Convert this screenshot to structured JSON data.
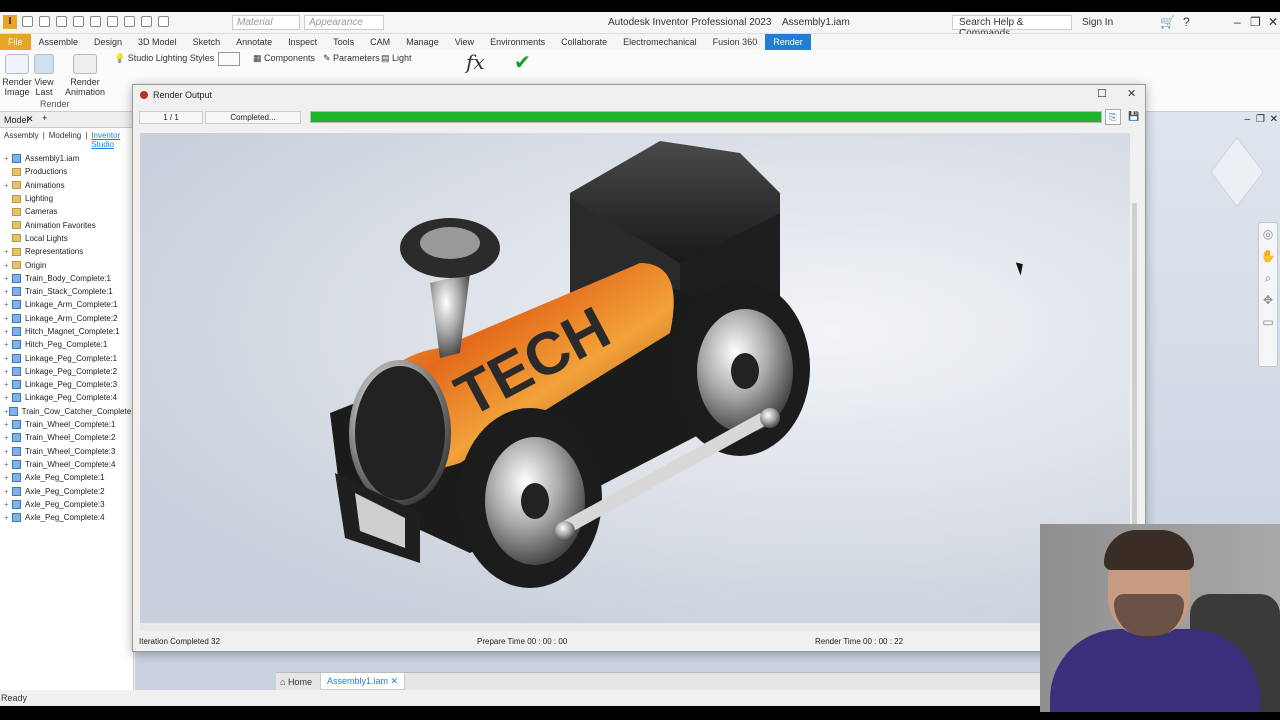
{
  "app": {
    "title": "Autodesk Inventor Professional 2023",
    "document": "Assembly1.iam",
    "search_help": "Search Help & Commands...",
    "sign_in": "Sign In",
    "material_select": "Material",
    "appearance_select": "Appearance",
    "logo_letter": "I"
  },
  "ribbon_tabs": [
    {
      "label": "File"
    },
    {
      "label": "Assemble"
    },
    {
      "label": "Design"
    },
    {
      "label": "3D Model"
    },
    {
      "label": "Sketch"
    },
    {
      "label": "Annotate"
    },
    {
      "label": "Inspect"
    },
    {
      "label": "Tools"
    },
    {
      "label": "CAM"
    },
    {
      "label": "Manage"
    },
    {
      "label": "View"
    },
    {
      "label": "Environments"
    },
    {
      "label": "Collaborate"
    },
    {
      "label": "Electromechanical"
    },
    {
      "label": "Fusion 360"
    },
    {
      "label": "Render"
    }
  ],
  "ribbon": {
    "render_image": "Render Image",
    "view_last": "View Last",
    "render_animation": "Render Animation",
    "studio_lighting_styles": "Studio Lighting Styles",
    "components": "Components",
    "parameters": "Parameters",
    "light": "Light",
    "group_render": "Render",
    "fx": "fx",
    "check": "✔"
  },
  "browser": {
    "title": "Model",
    "tabs": [
      "Assembly",
      "Modeling",
      "Inventor Studio"
    ],
    "items": [
      {
        "label": "Assembly1.iam",
        "type": "part"
      },
      {
        "label": "Productions",
        "type": "folder"
      },
      {
        "label": "Animations",
        "type": "folder"
      },
      {
        "label": "Lighting",
        "type": "folder"
      },
      {
        "label": "Cameras",
        "type": "folder"
      },
      {
        "label": "Animation Favorites",
        "type": "folder"
      },
      {
        "label": "Local Lights",
        "type": "folder"
      },
      {
        "label": "Representations",
        "type": "folder"
      },
      {
        "label": "Origin",
        "type": "folder"
      },
      {
        "label": "Train_Body_Complete:1",
        "type": "part"
      },
      {
        "label": "Train_Stack_Complete:1",
        "type": "part"
      },
      {
        "label": "Linkage_Arm_Complete:1",
        "type": "part"
      },
      {
        "label": "Linkage_Arm_Complete:2",
        "type": "part"
      },
      {
        "label": "Hitch_Magnet_Complete:1",
        "type": "part"
      },
      {
        "label": "Hitch_Peg_Complete:1",
        "type": "part"
      },
      {
        "label": "Linkage_Peg_Complete:1",
        "type": "part"
      },
      {
        "label": "Linkage_Peg_Complete:2",
        "type": "part"
      },
      {
        "label": "Linkage_Peg_Complete:3",
        "type": "part"
      },
      {
        "label": "Linkage_Peg_Complete:4",
        "type": "part"
      },
      {
        "label": "Train_Cow_Catcher_Complete:1",
        "type": "part"
      },
      {
        "label": "Train_Wheel_Complete:1",
        "type": "part"
      },
      {
        "label": "Train_Wheel_Complete:2",
        "type": "part"
      },
      {
        "label": "Train_Wheel_Complete:3",
        "type": "part"
      },
      {
        "label": "Train_Wheel_Complete:4",
        "type": "part"
      },
      {
        "label": "Axle_Peg_Complete:1",
        "type": "part"
      },
      {
        "label": "Axle_Peg_Complete:2",
        "type": "part"
      },
      {
        "label": "Axle_Peg_Complete:3",
        "type": "part"
      },
      {
        "label": "Axle_Peg_Complete:4",
        "type": "part"
      }
    ]
  },
  "render_dialog": {
    "title": "Render Output",
    "iteration": "1 / 1",
    "status": "Completed...",
    "progress": 1.0,
    "progress_color": "#1fb32d",
    "render_text": "TECH",
    "iteration_completed": "Iteration Completed  32",
    "prepare_time": "Prepare Time  00 : 00 : 00",
    "render_time": "Render Time  00 : 00 : 22"
  },
  "doc_tabs": {
    "home": "Home",
    "document": "Assembly1.iam"
  },
  "status_bar": "Ready"
}
